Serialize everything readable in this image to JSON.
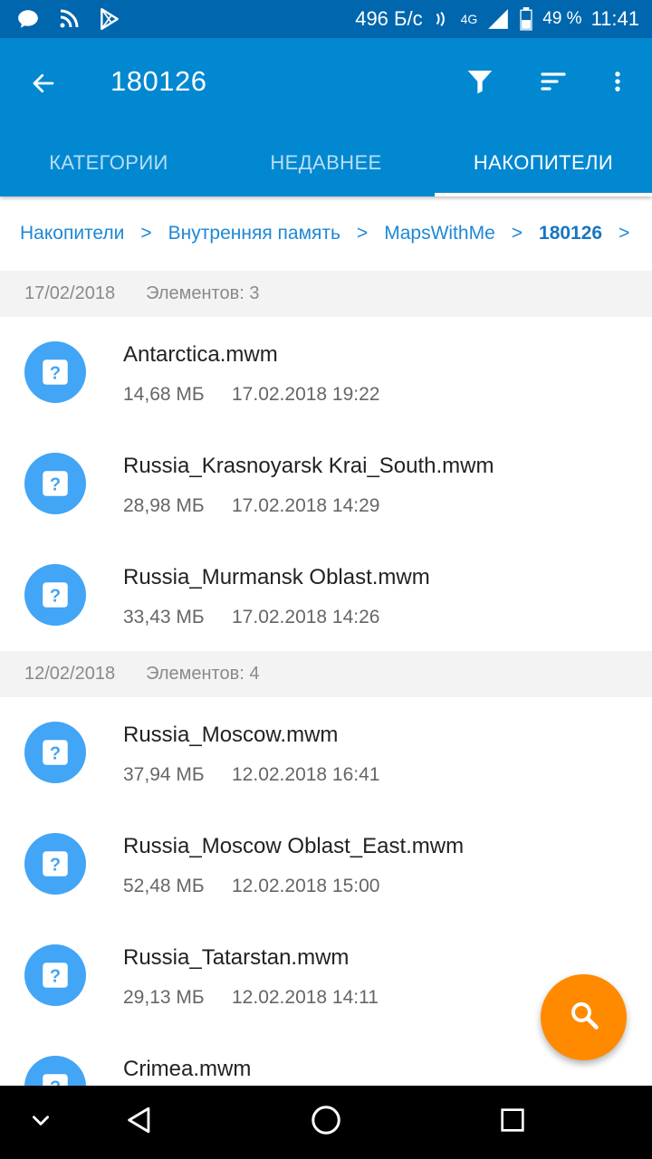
{
  "status_bar": {
    "speed": "496 Б/с",
    "battery": "49 %",
    "time": "11:41",
    "network": "4G"
  },
  "app_bar": {
    "title": "180126",
    "tabs": [
      {
        "label": "КАТЕГОРИИ",
        "active": false
      },
      {
        "label": "НЕДАВНЕЕ",
        "active": false
      },
      {
        "label": "НАКОПИТЕЛИ",
        "active": true
      }
    ]
  },
  "breadcrumb": {
    "items": [
      "Накопители",
      "Внутренняя память",
      "MapsWithMe",
      "180126"
    ],
    "separator": ">"
  },
  "groups": [
    {
      "date": "17/02/2018",
      "count": "Элементов: 3",
      "files": [
        {
          "name": "Antarctica.mwm",
          "size": "14,68 МБ",
          "modified": "17.02.2018 19:22"
        },
        {
          "name": "Russia_Krasnoyarsk Krai_South.mwm",
          "size": "28,98 МБ",
          "modified": "17.02.2018 14:29"
        },
        {
          "name": "Russia_Murmansk Oblast.mwm",
          "size": "33,43 МБ",
          "modified": "17.02.2018 14:26"
        }
      ]
    },
    {
      "date": "12/02/2018",
      "count": "Элементов: 4",
      "files": [
        {
          "name": "Russia_Moscow.mwm",
          "size": "37,94 МБ",
          "modified": "12.02.2018 16:41"
        },
        {
          "name": "Russia_Moscow Oblast_East.mwm",
          "size": "52,48 МБ",
          "modified": "12.02.2018 15:00"
        },
        {
          "name": "Russia_Tatarstan.mwm",
          "size": "29,13 МБ",
          "modified": "12.02.2018 14:11"
        },
        {
          "name": "Crimea.mwm",
          "size": "",
          "modified": ""
        }
      ]
    }
  ],
  "icons": {
    "file": "unknown-file-icon",
    "fab": "search-icon"
  },
  "colors": {
    "app_bar": "#0288d1",
    "status_bar": "#0066ad",
    "accent": "#ff8a00",
    "file_icon": "#42a5f5",
    "breadcrumb": "#1e88d6"
  }
}
